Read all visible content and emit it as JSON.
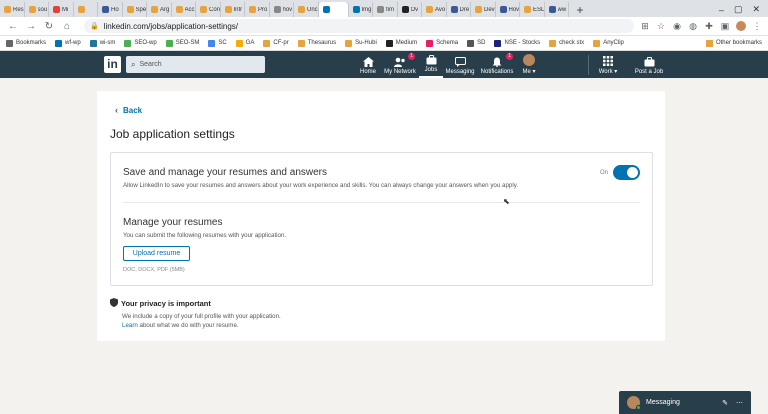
{
  "browser": {
    "tabs": [
      {
        "label": "Res",
        "color": "#e7a33e"
      },
      {
        "label": "sou",
        "color": "#e7a33e"
      },
      {
        "label": "Mi",
        "color": "#db4437"
      },
      {
        "label": "",
        "color": "#e7a33e"
      },
      {
        "label": "Ho",
        "color": "#3b5998"
      },
      {
        "label": "Spe",
        "color": "#e7a33e"
      },
      {
        "label": "Arg",
        "color": "#e7a33e"
      },
      {
        "label": "Acc",
        "color": "#e7a33e"
      },
      {
        "label": "Con",
        "color": "#e7a33e"
      },
      {
        "label": "Intr",
        "color": "#e7a33e"
      },
      {
        "label": "Pro",
        "color": "#e7a33e"
      },
      {
        "label": "hov",
        "color": "#888888"
      },
      {
        "label": "Unc",
        "color": "#e7a33e"
      },
      {
        "label": "",
        "color": "#0073b1",
        "active": true
      },
      {
        "label": "Img",
        "color": "#0073b1"
      },
      {
        "label": "fim",
        "color": "#888888"
      },
      {
        "label": "Ov",
        "color": "#222222"
      },
      {
        "label": "Avo",
        "color": "#e7a33e"
      },
      {
        "label": "Dre",
        "color": "#3b5998"
      },
      {
        "label": "Dev",
        "color": "#e7a33e"
      },
      {
        "label": "Hov",
        "color": "#3b5998"
      },
      {
        "label": "ESL",
        "color": "#e7a33e"
      },
      {
        "label": "ww",
        "color": "#3b5998"
      }
    ],
    "new_tab": "+",
    "win_min": "–",
    "win_max": "▢",
    "win_close": "✕",
    "url": "linkedin.com/jobs/application-settings/",
    "bookmarks": [
      {
        "label": "Bookmarks",
        "color": "#666666"
      },
      {
        "label": "wf-wp",
        "color": "#0073b1"
      },
      {
        "label": "wi-sm",
        "color": "#21759b"
      },
      {
        "label": "SEO-wp",
        "color": "#4caf50"
      },
      {
        "label": "SEO-SM",
        "color": "#4caf50"
      },
      {
        "label": "SC",
        "color": "#4285f4"
      },
      {
        "label": "GA",
        "color": "#f9ab00"
      },
      {
        "label": "CF-pr",
        "color": "#e7a33e"
      },
      {
        "label": "Thesaurus",
        "color": "#e7a33e"
      },
      {
        "label": "Su-Hubi",
        "color": "#e7a33e"
      },
      {
        "label": "Medium",
        "color": "#222222"
      },
      {
        "label": "Schema",
        "color": "#e91e63"
      },
      {
        "label": "SD",
        "color": "#555555"
      },
      {
        "label": "NSE - Stocks",
        "color": "#1a237e"
      },
      {
        "label": "check stx",
        "color": "#e7a33e"
      },
      {
        "label": "AnyClip",
        "color": "#e7a33e"
      }
    ],
    "other_bookmarks": "Other bookmarks"
  },
  "linkedin_nav": {
    "logo": "in",
    "search_placeholder": "Search",
    "items": [
      {
        "label": "Home",
        "icon": "home-icon",
        "badge": ""
      },
      {
        "label": "My Network",
        "icon": "network-icon",
        "badge": "1"
      },
      {
        "label": "Jobs",
        "icon": "briefcase-icon",
        "badge": "",
        "active": true
      },
      {
        "label": "Messaging",
        "icon": "chat-icon",
        "badge": ""
      },
      {
        "label": "Notifications",
        "icon": "bell-icon",
        "badge": "1"
      },
      {
        "label": "Me ▾",
        "icon": "avatar",
        "badge": ""
      }
    ],
    "work_label": "Work ▾",
    "post_job_label": "Post a Job"
  },
  "page": {
    "back_label": "Back",
    "title": "Job application settings",
    "save_section": {
      "title": "Save and manage your resumes and answers",
      "description": "Allow LinkedIn to save your resumes and answers about your work experience and skills. You can always change your answers when you apply.",
      "toggle_label": "On",
      "toggle_on": true
    },
    "resume_section": {
      "title": "Manage your resumes",
      "description": "You can submit the following resumes with your application.",
      "upload_label": "Upload resume",
      "formats": "DOC, DOCX, PDF (5MB)"
    },
    "privacy": {
      "title": "Your privacy is important",
      "line1": "We include a copy of your full profile with your application.",
      "learn": "Learn",
      "line2_rest": " about what we do with your resume."
    }
  },
  "messaging_dock": {
    "label": "Messaging"
  },
  "colors": {
    "linkedin_blue": "#0073b1",
    "nav_bg": "#283e4a",
    "page_bg": "#f3f2ef"
  }
}
